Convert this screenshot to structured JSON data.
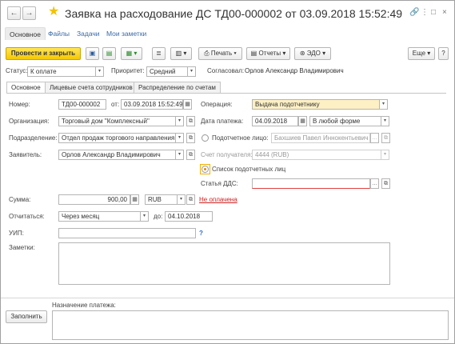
{
  "window": {
    "title": "Заявка на расходование ДС ТД00-000002 от 03.09.2018 15:52:49"
  },
  "nav": {
    "back_icon": "←",
    "forward_icon": "→"
  },
  "window_buttons": {
    "link": "🔗",
    "menu": "⋮",
    "maximize": "□",
    "close": "×"
  },
  "sections": [
    "Основное",
    "Файлы",
    "Задачи",
    "Мои заметки"
  ],
  "toolbar": {
    "post_close": "Провести и закрыть",
    "print": "Печать",
    "reports": "Отчеты",
    "edo": "ЭДО",
    "more": "Еще",
    "help": "?"
  },
  "status_row": {
    "status_label": "Статус:",
    "status_value": "К оплате",
    "priority_label": "Приоритет:",
    "priority_value": "Средний",
    "approved_label": "Согласовал:",
    "approved_value": "Орлов Александр Владимирович"
  },
  "tabs": [
    "Основное",
    "Лицевые счета сотрудников",
    "Распределение по счетам"
  ],
  "form": {
    "number_label": "Номер:",
    "number_value": "ТД00-000002",
    "from_label": "от:",
    "date_value": "03.09.2018 15:52:49",
    "operation_label": "Операция:",
    "operation_value": "Выдача подотчетнику",
    "org_label": "Организация:",
    "org_value": "Торговый дом \"Комплексный\"",
    "pay_date_label": "Дата платежа:",
    "pay_date_value": "04.09.2018",
    "pay_form_value": "В любой форме",
    "dept_label": "Подразделение:",
    "dept_value": "Отдел продаж торгового направления",
    "accountable_label": "Подотчетное лицо:",
    "accountable_value": "Бахшиев Павел Иннокентьевич",
    "applicant_label": "Заявитель:",
    "applicant_value": "Орлов Александр Владимирович",
    "recipient_account_label": "Счет получателя:",
    "recipient_account_value": "4444 (RUB)",
    "list_label": "Список подотчетных лиц",
    "dds_label": "Статья ДДС:",
    "dds_value": "",
    "sum_label": "Сумма:",
    "sum_value": "900,00",
    "currency_value": "RUB",
    "not_paid": "Не оплачена",
    "report_label": "Отчитаться:",
    "report_value": "Через месяц",
    "to_label": "до:",
    "report_date": "04.10.2018",
    "uip_label": "УИП:",
    "uip_value": "",
    "notes_label": "Заметки:",
    "purpose_label": "Назначение платежа:",
    "fill_button": "Заполнить"
  },
  "colors": {
    "primary_button": "#f5c800",
    "highlight_field": "#fdf0c4",
    "link": "#3a6aa6",
    "not_paid": "#d02020"
  }
}
